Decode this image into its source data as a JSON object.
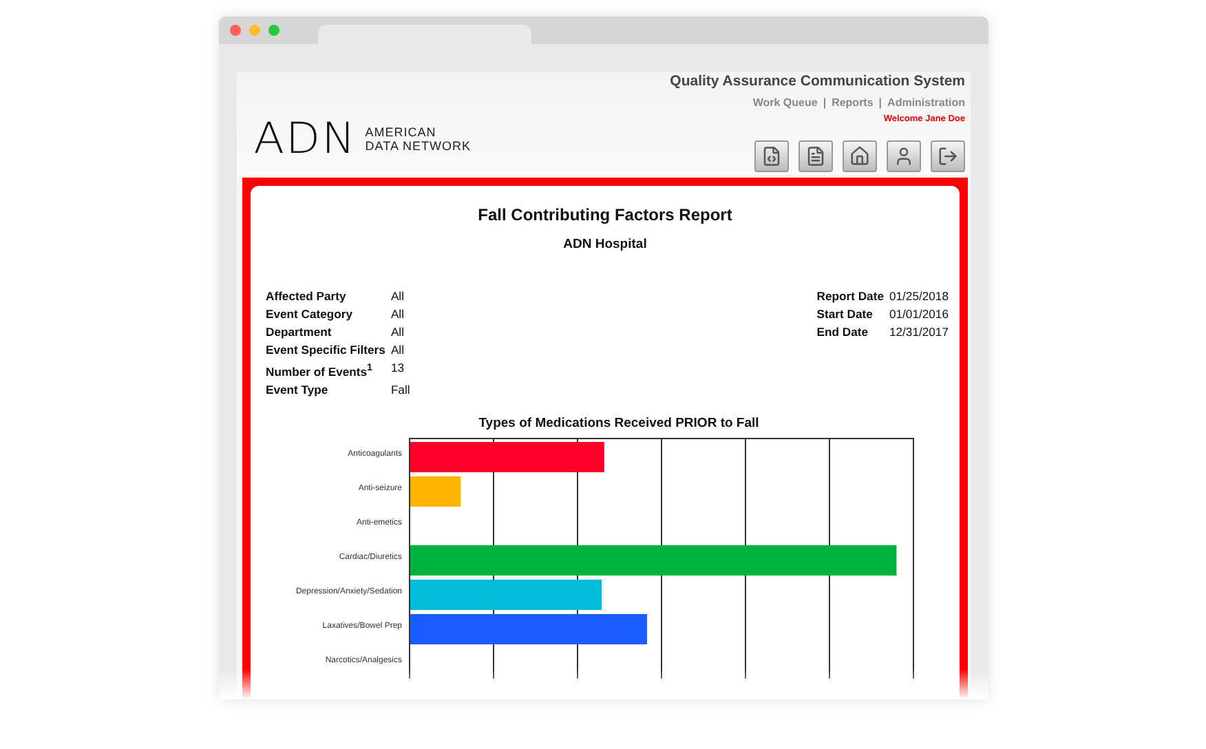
{
  "header": {
    "logo": "ADN",
    "company": [
      "AMERICAN",
      "DATA NETWORK"
    ],
    "system_title": "Quality Assurance Communication System",
    "nav": [
      {
        "label": "Work Queue",
        "separator": "|"
      },
      {
        "label": "Reports",
        "separator": "|"
      },
      {
        "label": "Administration"
      }
    ],
    "welcome": "Welcome Jane Doe",
    "toolbar": [
      {
        "kind": "xml"
      },
      {
        "kind": "document"
      },
      {
        "kind": "home"
      },
      {
        "kind": "user"
      },
      {
        "kind": "exit"
      }
    ]
  },
  "report": {
    "title": "Fall Contributing Factors Report",
    "subtitle": "ADN Hospital",
    "filters": [
      {
        "label": "Affected Party",
        "value": "All"
      },
      {
        "label": "Event Category",
        "value": "All"
      },
      {
        "label": "Department",
        "value": "All"
      },
      {
        "label": "Event Specific Filters",
        "value": "All"
      },
      {
        "label": "Number of Events$^{1}$",
        "value": "13"
      },
      {
        "label": "Event Type",
        "value": "Fall"
      }
    ],
    "dates": [
      {
        "label": "Report Date",
        "value": "01/25/2018"
      },
      {
        "label": "Start Date",
        "value": "01/01/2016"
      },
      {
        "label": "End Date",
        "value": "12/31/2017"
      }
    ],
    "chart": {
      "title": "Types of Medications Received PRIOR to Fall",
      "bars": [
        {
          "label": "Anticoagulants",
          "color": "#ff0028",
          "level": 0.385
        },
        {
          "label": "Anti-seizure",
          "color": "#ffb400",
          "level": 0.1
        },
        {
          "label": "Anti-emetics"
        },
        {
          "label": "Cardiac/Diuretics",
          "color": "#00b33c",
          "level": 0.965
        },
        {
          "label": "Depression/Anxiety/Sedation",
          "color": "#00bcd8",
          "level": 0.38
        },
        {
          "label": "Laxatives/Bowel Prep",
          "color": "#1a5cff",
          "level": 0.47
        },
        {
          "label": "Narcotics/Analgesics"
        }
      ]
    }
  }
}
